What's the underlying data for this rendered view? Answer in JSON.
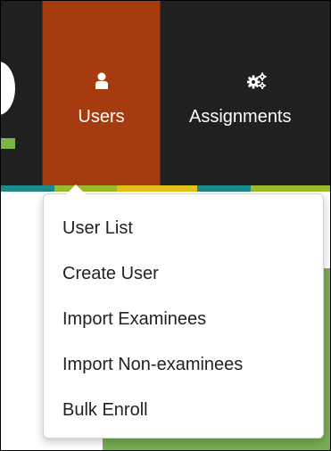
{
  "navbar": {
    "items": [
      {
        "label": "Users",
        "icon": "user-icon",
        "active": true
      },
      {
        "label": "Assignments",
        "icon": "gears-icon",
        "active": false
      }
    ]
  },
  "dropdown": {
    "items": [
      {
        "label": "User List"
      },
      {
        "label": "Create User"
      },
      {
        "label": "Import Examinees"
      },
      {
        "label": "Import Non-examinees"
      },
      {
        "label": "Bulk Enroll"
      }
    ]
  },
  "colors": {
    "navbar_bg": "#202020",
    "active_tab_bg": "#a63b10",
    "stripe": [
      "#1a8a8a",
      "#9bbb2c",
      "#e5c21a",
      "#7ab648"
    ],
    "content_green": "#79ad53"
  }
}
